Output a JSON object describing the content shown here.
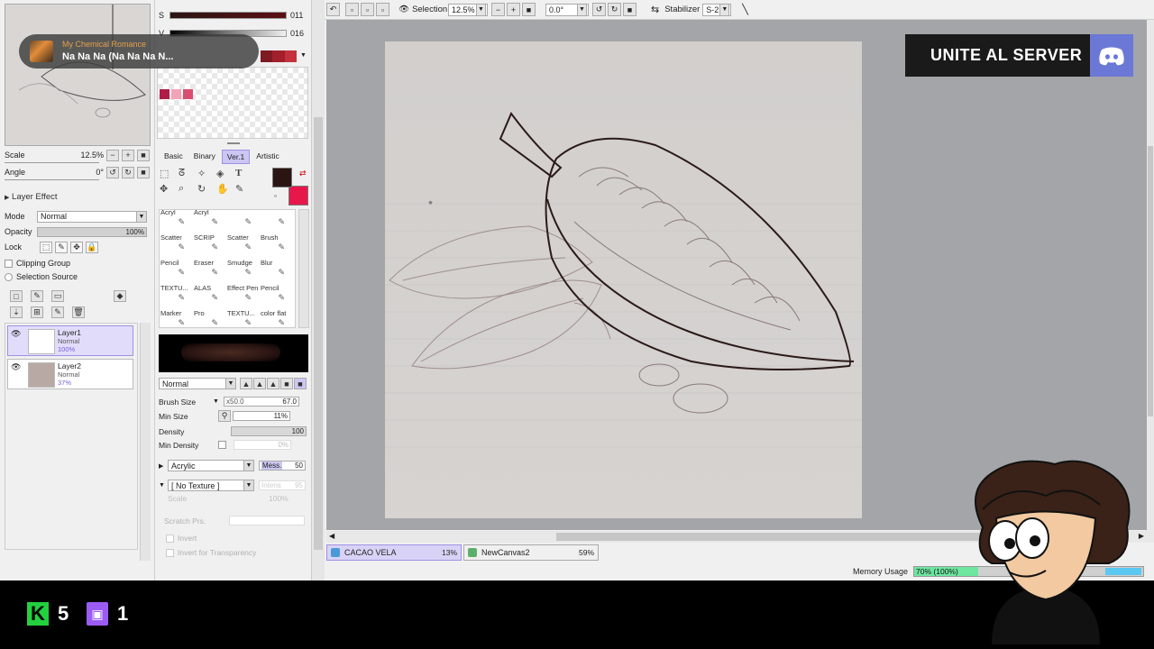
{
  "navigator": {
    "scale_label": "Scale",
    "scale_value": "12.5%",
    "angle_label": "Angle",
    "angle_value": "0°"
  },
  "layer_panel": {
    "layer_effect": "Layer Effect",
    "mode_label": "Mode",
    "mode_value": "Normal",
    "opacity_label": "Opacity",
    "opacity_value": "100%",
    "lock_label": "Lock",
    "clipping_group": "Clipping Group",
    "selection_source": "Selection Source",
    "layers": [
      {
        "name": "Layer1",
        "mode": "Normal",
        "opacity": "100%",
        "selected": true
      },
      {
        "name": "Layer2",
        "mode": "Normal",
        "opacity": "37%",
        "selected": false
      }
    ]
  },
  "music": {
    "artist": "My Chemical Romance",
    "track": "Na Na Na (Na Na Na N..."
  },
  "color": {
    "s_label": "S",
    "s_value": "011",
    "v_label": "V",
    "v_value": "016",
    "fg": "#2a1512",
    "bg": "#e8174a",
    "swatches": [
      "#b01c47",
      "#f3a3b6",
      "#d94d71"
    ]
  },
  "tool_tabs": [
    "Basic",
    "Binary",
    "Ver.1",
    "Artistic"
  ],
  "active_tool_tab": "Ver.1",
  "tools": [
    "Acryl",
    "Acryl",
    "",
    "",
    "Scatter",
    "SCRIP",
    "Scatter",
    "Brush",
    "Pencil",
    "Eraser",
    "Smudge",
    "Blur",
    "TEXTU...",
    "ALAS",
    "Effect Pen",
    "Pencil",
    "Marker",
    "Pro",
    "TEXTU...",
    "color flat"
  ],
  "brush": {
    "blend_mode": "Normal",
    "size_label": "Brush Size",
    "size_mult": "x50.0",
    "size_value": "67.0",
    "min_size_label": "Min Size",
    "min_size_value": "11%",
    "density_label": "Density",
    "density_value": "100",
    "min_density_label": "Min Density",
    "min_density_value": "0%",
    "paper": "Acrylic",
    "mess_label": "Mess.",
    "mess_value": "50",
    "texture": "[ No Texture ]",
    "texture_scale": "Scale",
    "texture_scale_value": "100%",
    "texture_intensity": "Intens",
    "texture_intensity_value": "95",
    "scratch_label": "Scratch Prs.",
    "invert": "Invert",
    "invert_transparency": "Invert for Transparency"
  },
  "toolbar": {
    "selection_label": "Selection",
    "zoom": "12.5%",
    "rotation": "0.0°",
    "stabilizer_label": "Stabilizer",
    "stabilizer_value": "S-2"
  },
  "documents": [
    {
      "name": "CACAO VELA",
      "zoom": "13%",
      "active": true
    },
    {
      "name": "NewCanvas2",
      "zoom": "59%",
      "active": false
    }
  ],
  "memory": {
    "label": "Memory Usage",
    "value": "70% (100%)",
    "fraction": 0.28
  },
  "discord": {
    "text": "UNITE AL SERVER"
  },
  "stream_stats": {
    "kick_count": "5",
    "twitch_count": "1"
  }
}
